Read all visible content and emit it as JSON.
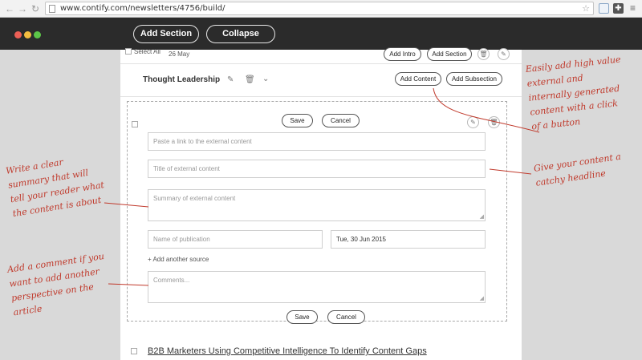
{
  "browser": {
    "back_glyph": "←",
    "forward_glyph": "→",
    "reload_glyph": "↻",
    "url": "www.contify.com/newsletters/4756/build/",
    "star_glyph": "☆"
  },
  "toolbar": {
    "add_section_label": "Add Section",
    "collapse_label": "Collapse",
    "window_colors": [
      "#ec5f56",
      "#f4bd40",
      "#5cc548"
    ]
  },
  "previous_row": {
    "select_all_label": "Select All",
    "date": "26 May",
    "add_intro_label": "Add Intro",
    "add_section_label": "Add Section"
  },
  "section": {
    "title": "Thought Leadership",
    "add_content_label": "Add Content",
    "add_subsection_label": "Add Subsection"
  },
  "form": {
    "save_label": "Save",
    "cancel_label": "Cancel",
    "link_placeholder": "Paste a link to the external content",
    "title_placeholder": "Title of external content",
    "summary_placeholder": "Summary of external content",
    "publication_placeholder": "Name of publication",
    "date_value": "Tue, 30 Jun 2015",
    "add_source_label": "+ Add another source",
    "comments_placeholder": "Comments..."
  },
  "article": {
    "title": "B2B Marketers Using Competitive Intelligence To Identify Content Gaps"
  },
  "annotations": {
    "add_value": [
      "Easily add high value",
      "external and",
      "internally generated",
      "content with a click",
      "of a button"
    ],
    "headline": [
      "Give your content a",
      "catchy headline"
    ],
    "summary": [
      "Write a clear",
      "summary that will",
      "tell your reader what",
      "the content is about"
    ],
    "comment": [
      "Add a comment if you",
      "want to add another",
      "perspective on the",
      "article"
    ]
  },
  "colors": {
    "annotation": "#c0392b",
    "app_bar": "#2b2b2b",
    "background": "#d9d9d9"
  }
}
